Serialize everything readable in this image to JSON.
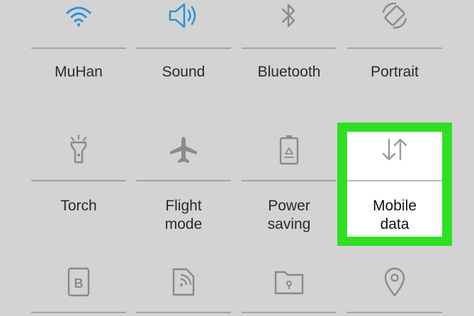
{
  "quick_settings": {
    "row1": [
      {
        "label": "MuHan",
        "icon": "wifi-icon",
        "active": true
      },
      {
        "label": "Sound",
        "icon": "speaker-icon",
        "active": true
      },
      {
        "label": "Bluetooth",
        "icon": "bluetooth-icon",
        "active": false
      },
      {
        "label": "Portrait",
        "icon": "rotate-icon",
        "active": false
      }
    ],
    "row2": [
      {
        "label": "Torch",
        "icon": "torch-icon",
        "active": false
      },
      {
        "label": "Flight\nmode",
        "icon": "airplane-icon",
        "active": false
      },
      {
        "label": "Power\nsaving",
        "icon": "battery-recycle-icon",
        "active": false
      },
      {
        "label": "Mobile\ndata",
        "icon": "data-arrows-icon",
        "active": false,
        "highlighted": true
      }
    ],
    "row3": [
      {
        "icon": "blocking-mode-icon"
      },
      {
        "icon": "nfc-icon"
      },
      {
        "icon": "secure-folder-icon"
      },
      {
        "icon": "location-icon"
      }
    ]
  },
  "colors": {
    "background": "#d3d3d3",
    "active_icon": "#2a96d6",
    "inactive_icon": "#8a8a8a",
    "highlight": "#2fe022",
    "divider": "#a4a4a4"
  }
}
